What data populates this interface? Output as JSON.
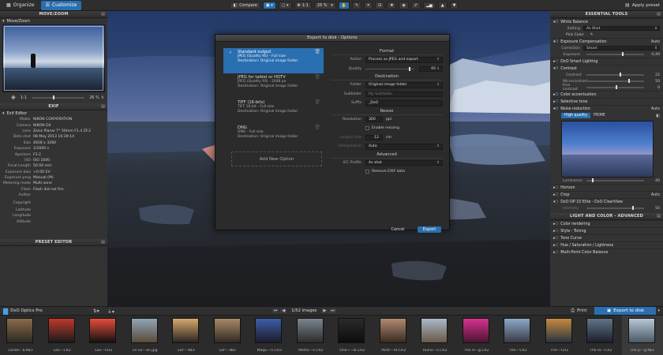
{
  "topbar": {
    "tabs": [
      {
        "label": "Organize"
      },
      {
        "label": "Customize"
      }
    ],
    "compare_label": "Compare",
    "zoom_ratio": "1:1",
    "zoom_percent": "26 %",
    "apply_preset": "Apply preset"
  },
  "left": {
    "movezoom_title": "MOVE/ZOOM",
    "movezoom_sub": "Move/Zoom",
    "zoom_ratio": "1:1",
    "zoom_percent": "26 %",
    "exif_title": "EXIF",
    "exif_sub": "Exif Editor",
    "exif_rows": [
      {
        "k": "Maker",
        "v": "NIKON CORPORATION"
      },
      {
        "k": "Camera",
        "v": "NIKON D4"
      },
      {
        "k": "Lens",
        "v": "Zeiss Planar T* 50mm F1.4 ZF.2"
      },
      {
        "k": "Date shot",
        "v": "08 May 2013 16:39:14"
      },
      {
        "k": "Size",
        "v": "4928 x 3280"
      },
      {
        "k": "Exposure",
        "v": "1/2000 s"
      },
      {
        "k": "Aperture",
        "v": "F3.2"
      },
      {
        "k": "ISO",
        "v": "ISO 1600"
      },
      {
        "k": "Focal Length",
        "v": "50.00 mm"
      },
      {
        "k": "Exposure bias",
        "v": "+0.00 EV"
      },
      {
        "k": "Exposure prog",
        "v": "Manual (M)"
      },
      {
        "k": "Metering mode",
        "v": "Multi-zone"
      },
      {
        "k": "Flash",
        "v": "Flash did not fire."
      },
      {
        "k": "Author",
        "v": ""
      },
      {
        "k": "Copyright",
        "v": ""
      },
      {
        "k": "Latitude",
        "v": ""
      },
      {
        "k": "Longitude",
        "v": ""
      },
      {
        "k": "Altitude",
        "v": ""
      }
    ],
    "preset_title": "PRESET EDITOR"
  },
  "dialog": {
    "title": "Export to disk - Options",
    "options": [
      {
        "title": "Standard output",
        "l1": "JPEG (Quality 95) - Full size",
        "l2": "Destination: Original image folder"
      },
      {
        "title": "JPEG for tablet or HDTV",
        "l1": "JPEG (Quality 93) - 2048 px",
        "l2": "Destination: Original image folder"
      },
      {
        "title": "TIFF (16-bits)",
        "l1": "TIFF 16-bit - Full size",
        "l2": "Destination: Original image folder"
      },
      {
        "title": "DNG",
        "l1": "DNG - Full size",
        "l2": "Destination: Original image folder"
      }
    ],
    "add_option": "Add New Option",
    "format_title": "Format",
    "action_k": "Action",
    "action_v": "Process as JPEG and export",
    "quality_k": "Quality",
    "quality_v": "95",
    "dest_title": "Destination",
    "folder_k": "Folder",
    "folder_v": "Original image folder",
    "subfolder_k": "Subfolder",
    "subfolder_v": "My Subfolder",
    "suffix_k": "Suffix",
    "suffix_v": "_DxO",
    "resize_title": "Resize",
    "resolution_k": "Resolution",
    "resolution_v": "300",
    "resolution_u": "ppi",
    "enable_resizing": "Enable resizing",
    "largest_k": "Largest side",
    "largest_v": "12",
    "largest_u": "cm",
    "interp_k": "Interpolation",
    "interp_v": "Auto",
    "adv_title": "Advanced",
    "icc_k": "ICC Profile",
    "icc_v": "As shot",
    "remove_exif": "Remove EXIF data",
    "cancel": "Cancel",
    "export": "Export"
  },
  "right": {
    "title": "ESSENTIAL TOOLS",
    "white_balance": "White Balance",
    "wb_setting_k": "Setting",
    "wb_setting_v": "As Shot",
    "pick_color": "Pick Color",
    "exp_comp": "Exposure Compensation",
    "exp_auto": "Auto",
    "correction_k": "Correction",
    "correction_v": "Smart",
    "exposure_k": "Exposure",
    "exposure_v": "-0,49",
    "smart_lighting": "DxO Smart Lighting",
    "contrast": "Contrast",
    "contrast_k": "Contrast",
    "contrast_v": "22",
    "micro_k": "Microcontrast",
    "micro_v": "50",
    "fine_k": "Fine contrast",
    "fine_v": "0",
    "color_acc": "Color accentuation",
    "selective_tone": "Selective tone",
    "noise": "Noise reduction",
    "noise_auto": "Auto",
    "hq": "High quality",
    "prime": "PRIME",
    "luminance_k": "Luminance",
    "luminance_v": "40",
    "horizon": "Horizon",
    "crop": "Crop",
    "crop_auto": "Auto",
    "clearview": "DxO OP 10 Elite - DxO ClearView",
    "intensity_k": "Intensity",
    "intensity_v": "50",
    "lc_title": "LIGHT AND COLOR - ADVANCED",
    "lc_items": [
      {
        "label": "Color rendering"
      },
      {
        "label": "Style - Toning"
      },
      {
        "label": "Tone Curve"
      },
      {
        "label": "Hue / Saturation / Lightness"
      },
      {
        "label": "Multi-Point Color Balance"
      }
    ]
  },
  "filmstrip": {
    "folder": "DxO Optics Pro",
    "count": "1/52 images",
    "print": "Print",
    "export_disk": "Export to disk",
    "thumbs": [
      {
        "name": "Lands-- b.NEF",
        "c1": "#8a6b4a",
        "c2": "#2d2a26"
      },
      {
        "name": "Las---CR2",
        "c1": "#c0392b",
        "c2": "#1a1a1a"
      },
      {
        "name": "Las---CR2",
        "c1": "#e74c3c",
        "c2": "#111"
      },
      {
        "name": "Le Lo---on.jpg",
        "c1": "#8fa5b5",
        "c2": "#5b4a3a"
      },
      {
        "name": "Lof---.NEF",
        "c1": "#d7a86e",
        "c2": "#2a2520"
      },
      {
        "name": "Lof---.NEF",
        "c1": "#a88a66",
        "c2": "#302a24"
      },
      {
        "name": "Maqu---n.CR2",
        "c1": "#3d5ea8",
        "c2": "#1c1c2a"
      },
      {
        "name": "Metro---s.CR2",
        "c1": "#7a8590",
        "c2": "#2c2c2c"
      },
      {
        "name": "One i---al.CR2",
        "c1": "#2b2b2b",
        "c2": "#0c0c0c"
      },
      {
        "name": "Portr---et.CR2",
        "c1": "#b08a70",
        "c2": "#3a2a22"
      },
      {
        "name": "Ruins---s.CR2",
        "c1": "#a9b8c8",
        "c2": "#6a5848"
      },
      {
        "name": "The d---g.CR2",
        "c1": "#d6338f",
        "c2": "#4a1432"
      },
      {
        "name": "The---CR2",
        "c1": "#89a9c6",
        "c2": "#3a3a48"
      },
      {
        "name": "The---CR2",
        "c1": "#c78a3e",
        "c2": "#2a3340"
      },
      {
        "name": "The la---CR2",
        "c1": "#60748a",
        "c2": "#1a2028"
      },
      {
        "name": "The p---g.NEF",
        "c1": "#b7c7d6",
        "c2": "#4a5866"
      }
    ]
  }
}
